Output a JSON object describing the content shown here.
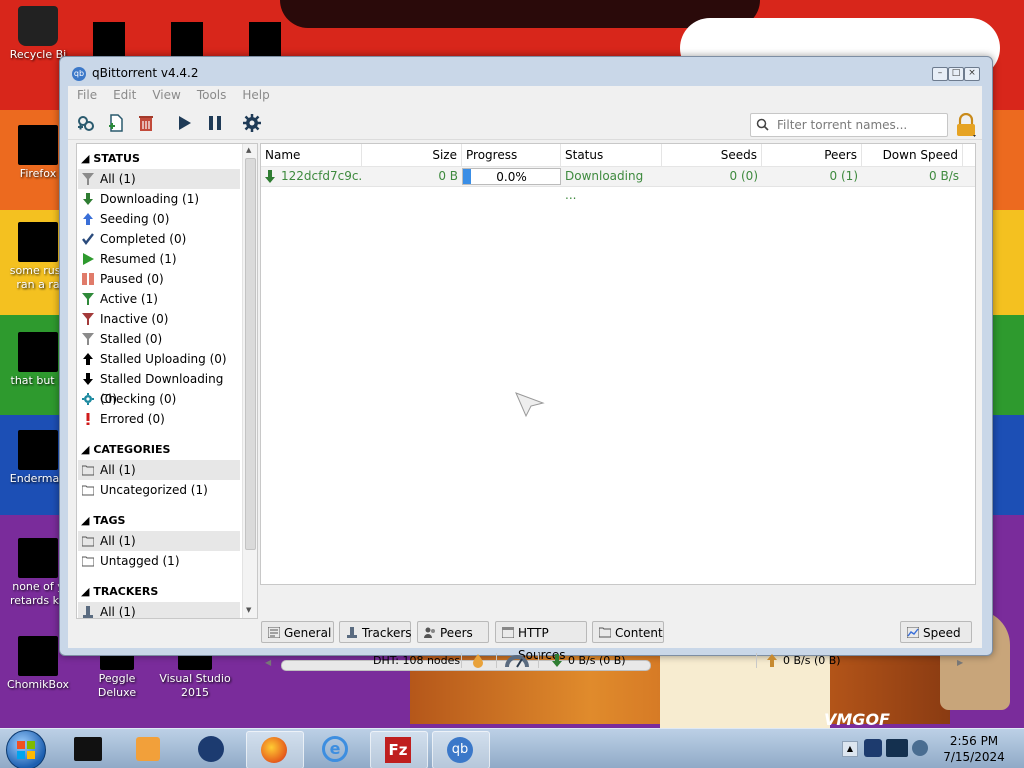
{
  "desktop": {
    "icons": [
      {
        "label": "Recycle Bi",
        "icon": "recycle-bin-icon"
      },
      {
        "label": "Firefox",
        "icon": "firefox-icon"
      },
      {
        "label": "some russ ran a ra",
        "icon": "file-icon"
      },
      {
        "label": "that but it",
        "icon": "file-icon"
      },
      {
        "label": "Enderman",
        "icon": "file-icon"
      },
      {
        "label": "none of y retards kn",
        "icon": "file-icon"
      },
      {
        "label": "ChomikBox",
        "icon": "chomikbox-icon"
      },
      {
        "label": "Peggle Deluxe",
        "icon": "peggle-icon"
      },
      {
        "label": "Visual Studio 2015",
        "icon": "visual-studio-icon"
      }
    ],
    "wallpaper_text": "VMGOF"
  },
  "window": {
    "title": "qBittorrent v4.4.2",
    "menu": [
      "File",
      "Edit",
      "View",
      "Tools",
      "Help"
    ],
    "toolbar": {
      "buttons": [
        "add-link-icon",
        "add-file-icon",
        "delete-icon",
        "resume-icon",
        "pause-icon",
        "options-icon"
      ],
      "filter_placeholder": "Filter torrent names...",
      "filter_value": ""
    },
    "sidebar": {
      "status_title": "STATUS",
      "status_items": [
        {
          "label": "All (1)",
          "icon": "filter-icon",
          "color": "#8b8b8b"
        },
        {
          "label": "Downloading (1)",
          "icon": "arrow-down-icon",
          "color": "#2f7d32"
        },
        {
          "label": "Seeding (0)",
          "icon": "arrow-up-icon",
          "color": "#3a6fd8"
        },
        {
          "label": "Completed (0)",
          "icon": "checkmark-icon",
          "color": "#2a4b7c"
        },
        {
          "label": "Resumed (1)",
          "icon": "play-icon",
          "color": "#2e9a2e"
        },
        {
          "label": "Paused (0)",
          "icon": "pause-icon",
          "color": "#e07b6a"
        },
        {
          "label": "Active (1)",
          "icon": "filter-icon",
          "color": "#2f8a3a"
        },
        {
          "label": "Inactive (0)",
          "icon": "filter-icon",
          "color": "#a33a3a"
        },
        {
          "label": "Stalled (0)",
          "icon": "filter-icon",
          "color": "#8b8b8b"
        },
        {
          "label": "Stalled Uploading (0)",
          "icon": "arrow-up-icon",
          "color": "#000000"
        },
        {
          "label": "Stalled Downloading (0)",
          "icon": "arrow-down-icon",
          "color": "#000000"
        },
        {
          "label": "Checking (0)",
          "icon": "gear-icon",
          "color": "#1e8aa0"
        },
        {
          "label": "Errored (0)",
          "icon": "exclamation-icon",
          "color": "#d01b1b"
        }
      ],
      "categories_title": "CATEGORIES",
      "category_items": [
        {
          "label": "All (1)",
          "icon": "folder-icon"
        },
        {
          "label": "Uncategorized (1)",
          "icon": "folder-icon"
        }
      ],
      "tags_title": "TAGS",
      "tag_items": [
        {
          "label": "All (1)",
          "icon": "folder-icon"
        },
        {
          "label": "Untagged (1)",
          "icon": "folder-icon"
        }
      ],
      "trackers_title": "TRACKERS",
      "tracker_items": [
        {
          "label": "All (1)",
          "icon": "tracker-icon"
        }
      ]
    },
    "table": {
      "columns": [
        "Name",
        "Size",
        "Progress",
        "Status",
        "Seeds",
        "Peers",
        "Down Speed"
      ],
      "rows": [
        {
          "name": "122dcfd7c9c...",
          "size": "0 B",
          "progress": "0.0%",
          "status": "Downloading ...",
          "seeds": "0 (0)",
          "peers": "0 (1)",
          "down_speed": "0 B/s"
        }
      ]
    },
    "bottom_tabs": [
      "General",
      "Trackers",
      "Peers",
      "HTTP Sources",
      "Content"
    ],
    "speed_tab": "Speed",
    "statusbar": {
      "dht": "DHT: 108 nodes",
      "download": "0 B/s (0 B)",
      "upload": "0 B/s (0 B)"
    }
  },
  "taskbar": {
    "apps": [
      "start-button",
      "console-icon",
      "media-player-icon",
      "browser-icon",
      "firefox-icon",
      "internet-explorer-icon",
      "filezilla-icon",
      "qbittorrent-icon"
    ],
    "time": "2:56 PM",
    "date": "7/15/2024"
  }
}
